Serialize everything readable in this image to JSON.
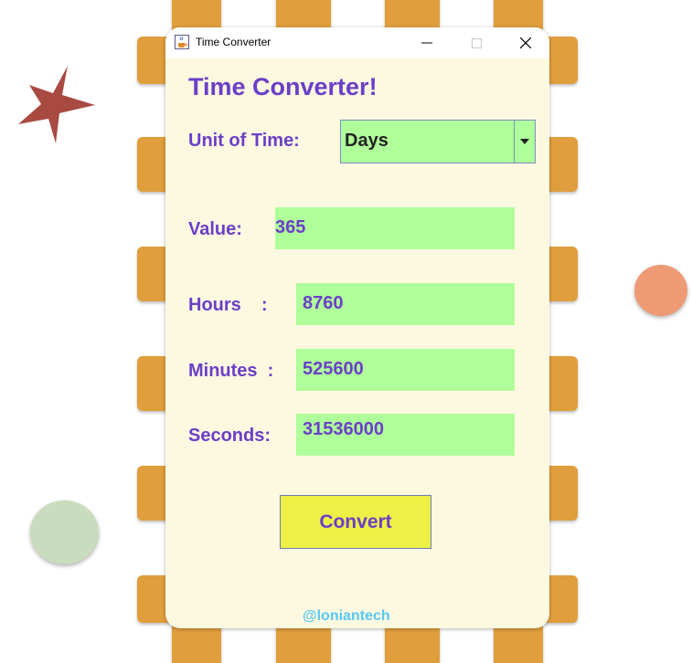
{
  "window": {
    "title": "Time Converter",
    "minimize_glyph": "—",
    "maximize_glyph": "☐",
    "close_glyph": "✕"
  },
  "form": {
    "heading": "Time Converter!",
    "unit_label": "Unit of Time:",
    "unit_selected": "Days",
    "value_label": "Value:",
    "value": "365",
    "hours_label": "Hours    :",
    "hours_value": "8760",
    "minutes_label": "Minutes  :",
    "minutes_value": "525600",
    "seconds_label": "Seconds:",
    "seconds_value": "31536000",
    "convert_label": "Convert"
  },
  "footer": {
    "credit": "@loniantech"
  },
  "colors": {
    "accent_text": "#6b3fc7",
    "field_bg": "#afff9a",
    "button_bg": "#eef045",
    "window_bg": "#fdf8e0",
    "frame_tab": "#e09e3c",
    "credit": "#57c8f2"
  },
  "icons": {
    "app": "java-cup-icon",
    "decor_star": "star-icon"
  }
}
